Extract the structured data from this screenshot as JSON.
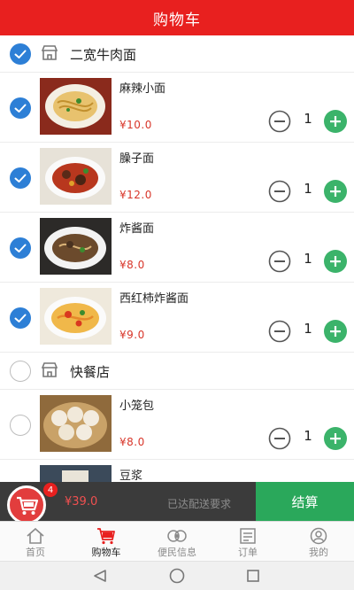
{
  "header": {
    "title": "购物车"
  },
  "shops": [
    {
      "name": "二宽牛肉面",
      "checked": true
    },
    {
      "name": "快餐店",
      "checked": false
    }
  ],
  "items": [
    {
      "name": "麻辣小面",
      "price": "¥10.0",
      "qty": "1",
      "checked": true
    },
    {
      "name": "臊子面",
      "price": "¥12.0",
      "qty": "1",
      "checked": true
    },
    {
      "name": "炸酱面",
      "price": "¥8.0",
      "qty": "1",
      "checked": true
    },
    {
      "name": "西红柿炸酱面",
      "price": "¥9.0",
      "qty": "1",
      "checked": true
    },
    {
      "name": "小笼包",
      "price": "¥8.0",
      "qty": "1",
      "checked": false
    },
    {
      "name": "豆浆",
      "checked": false
    }
  ],
  "checkout": {
    "badge_count": "4",
    "total": "¥39.0",
    "delivery_status": "已达配送要求",
    "checkout_label": "结算"
  },
  "tabs": [
    {
      "label": "首页",
      "icon": "home-icon",
      "active": false
    },
    {
      "label": "购物车",
      "icon": "cart-icon",
      "active": true
    },
    {
      "label": "便民信息",
      "icon": "info-icon",
      "active": false
    },
    {
      "label": "订单",
      "icon": "order-icon",
      "active": false
    },
    {
      "label": "我的",
      "icon": "profile-icon",
      "active": false
    }
  ],
  "system_nav": [
    "back-icon",
    "home-circle-icon",
    "recents-icon"
  ],
  "colors": {
    "brand_red": "#e8201f",
    "check_blue": "#2d7fd6",
    "plus_green": "#3bb36a",
    "price_red": "#d8362a",
    "checkout_green": "#2aa85b"
  }
}
